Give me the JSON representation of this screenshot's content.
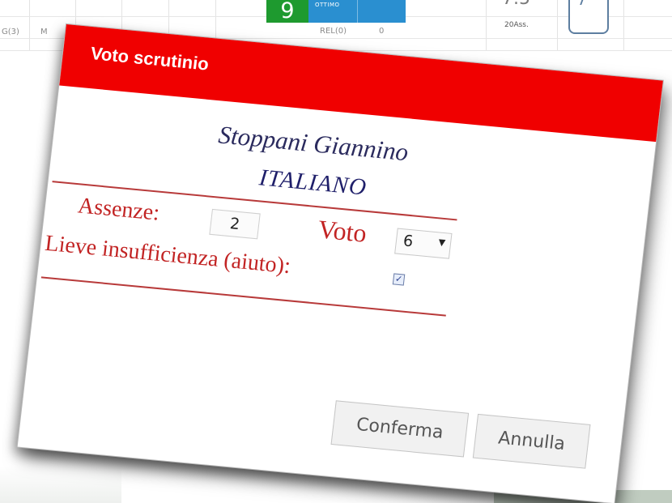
{
  "background": {
    "green_tile_value": "9",
    "blue_tile_label": "OTTIMO",
    "row_texts": [
      "G(3)",
      "M",
      "REL(0)",
      "0"
    ],
    "average": "7.5",
    "absences_sub": "20Ass.",
    "doc_icon": "document-icon"
  },
  "dialog": {
    "title": "Voto scrutinio",
    "student_name": "Stoppani Giannino",
    "subject": "ITALIANO",
    "absences_label": "Assenze:",
    "absences_value": "2",
    "vote_label": "Voto",
    "vote_value": "6",
    "help_label": "Lieve insufficienza (aiuto):",
    "help_checked": true,
    "confirm_label": "Conferma",
    "cancel_label": "Annulla"
  },
  "colors": {
    "titlebar": "#f00000",
    "label_red": "#c22424",
    "name_blue": "#2b2b5e",
    "grade_green": "#1e9a2f",
    "grade_blue": "#2a8fd0"
  }
}
